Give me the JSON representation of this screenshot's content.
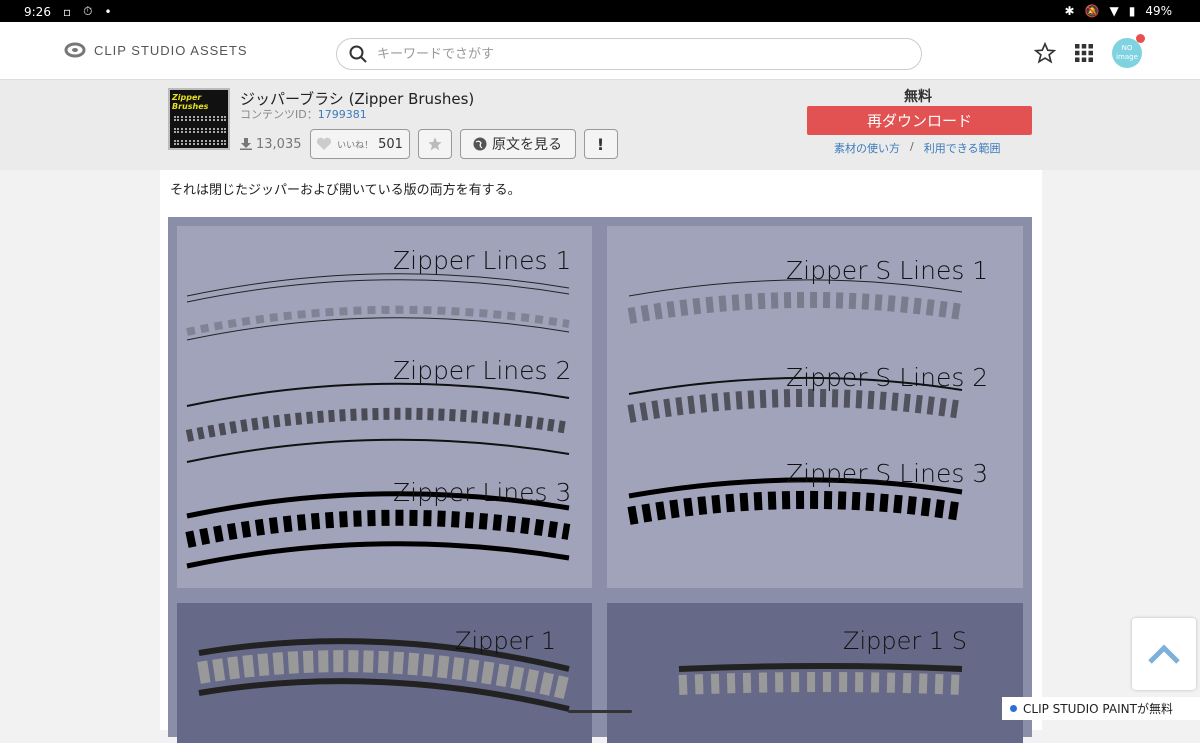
{
  "status": {
    "time": "9:26",
    "battery": "49%"
  },
  "header": {
    "logo_text": "CLIP STUDIO ASSETS",
    "search_placeholder": "キーワードでさがす",
    "avatar_text": "NO",
    "avatar_sub": "image"
  },
  "material": {
    "thumb_text": "Zipper Brushes",
    "title": "ジッパーブラシ (Zipper Brushes)",
    "content_id_label": "コンテンツID：",
    "content_id": "1799381",
    "downloads": "13,035",
    "like_label": "いいね！",
    "likes": "501",
    "original_label": "原文を見る",
    "report_label": "!",
    "price": "無料",
    "download_label": "再ダウンロード",
    "link_usage": "素材の使い方",
    "link_sep": "/",
    "link_scope": "利用できる範囲"
  },
  "description": "それは閉じたジッパーおよび開いている版の両方を有する。",
  "preview": {
    "label_1": "Zipper Lines 1",
    "label_2": "Zipper Lines 2",
    "label_3": "Zipper Lines 3",
    "label_s1": "Zipper S Lines 1",
    "label_s2": "Zipper S Lines 2",
    "label_s3": "Zipper S Lines 3",
    "label_z1": "Zipper 1",
    "label_z1s": "Zipper 1 S"
  },
  "promo": {
    "text": "CLIP STUDIO PAINTが無料"
  },
  "colors": {
    "accent": "#e25252",
    "link": "#3a7bbd",
    "preview_bg": "#8a8ea8"
  }
}
